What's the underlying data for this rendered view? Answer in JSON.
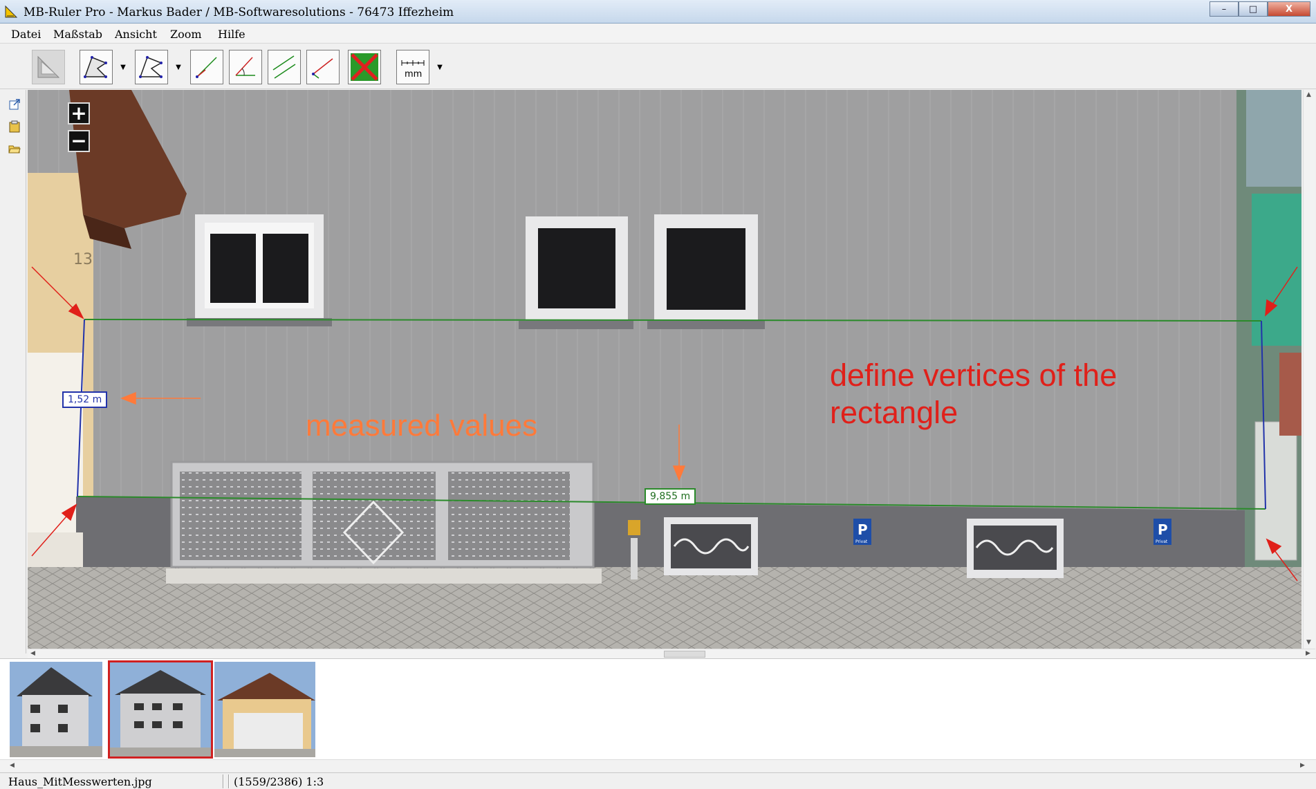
{
  "window": {
    "title": "MB-Ruler Pro - Markus Bader / MB-Softwaresolutions - 76473 Iffezheim",
    "minimize_glyph": "–",
    "maximize_glyph": "□",
    "close_glyph": "X"
  },
  "menu": [
    "Datei",
    "Maßstab",
    "Ansicht",
    "Zoom",
    "Hilfe"
  ],
  "toolbar": {
    "unit_label": "mm",
    "tools": [
      "perspective-icon",
      "polygon-area-icon",
      "polygon-line-icon",
      "angle-line-icon",
      "angle-icon",
      "parallel-lines-icon",
      "distance-line-icon",
      "delete-icon",
      "ruler-unit-icon"
    ]
  },
  "sidebar": {
    "icons": [
      "export-icon",
      "clipboard-icon",
      "open-folder-icon"
    ]
  },
  "viewport": {
    "zoom_in": "+",
    "zoom_out": "−",
    "house_number": "13",
    "parking_sign": "P",
    "parking_sub": "Privat",
    "measurements": {
      "height": "1,52 m",
      "width": "9,855 m"
    },
    "annotations": {
      "measured": "measured values",
      "vertices_line1": "define vertices of the",
      "vertices_line2": "rectangle"
    },
    "colors": {
      "measure_line": "#2a8a2a",
      "vertical_line": "#2233aa",
      "arrow_red": "#e0201a",
      "arrow_orange": "#ff7a3a"
    }
  },
  "thumbnails": [
    {
      "name": "house-front-thumbnail",
      "selected": false
    },
    {
      "name": "house-measured-thumbnail",
      "selected": true
    },
    {
      "name": "garage-thumbnail",
      "selected": false
    }
  ],
  "status": {
    "filename": "Haus_MitMesswerten.jpg",
    "info": "(1559/2386) 1:3"
  }
}
